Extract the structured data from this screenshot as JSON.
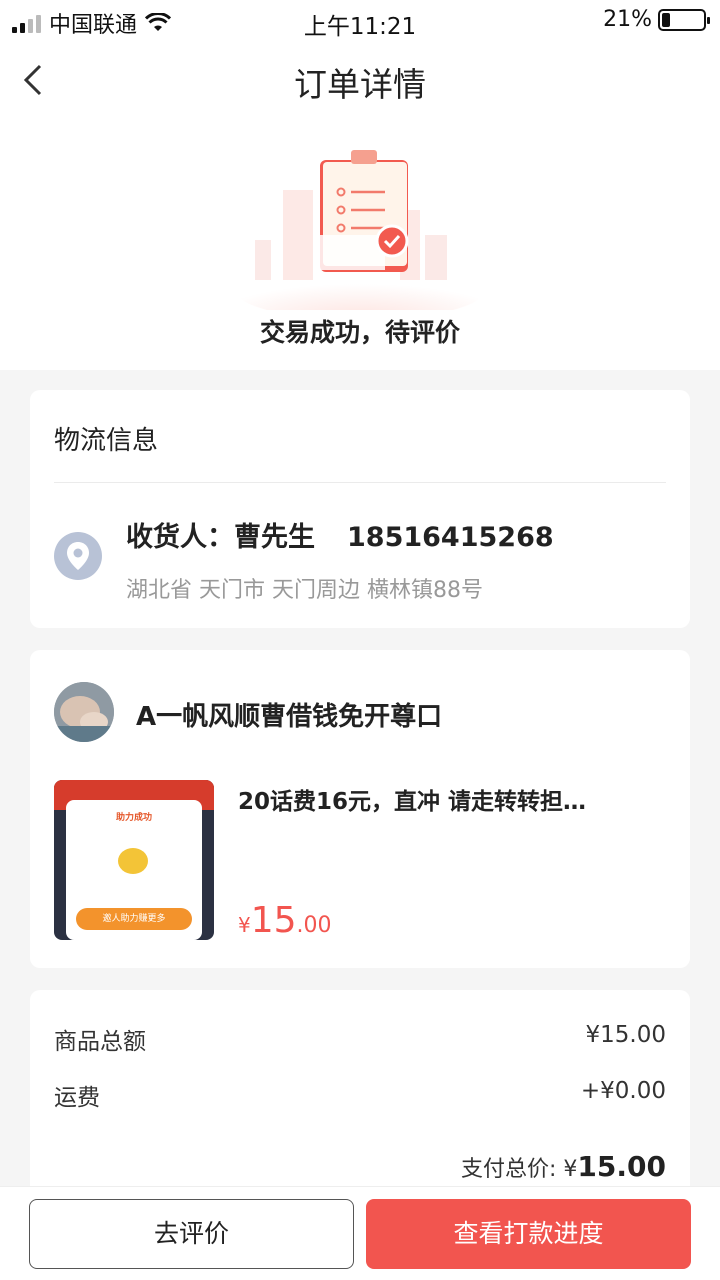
{
  "status_bar": {
    "carrier": "中国联通",
    "time": "上午11:21",
    "battery_percent": "21%",
    "battery_level": 0.21
  },
  "nav": {
    "title": "订单详情"
  },
  "hero": {
    "status_text": "交易成功，待评价"
  },
  "logistics": {
    "title": "物流信息",
    "receiver_label": "收货人：曹先生",
    "phone": "18516415268",
    "address": "湖北省 天门市 天门周边 横林镇88号"
  },
  "product": {
    "shop_name": "A一帆风顺曹借钱免开尊口",
    "name": "20话费16元，直冲 请走转转担…",
    "price_currency": "¥",
    "price_int": "15",
    "price_dec": ".00",
    "thumb_title": "助力成功",
    "thumb_button": "邀人助力赚更多"
  },
  "summary": {
    "goods_label": "商品总额",
    "goods_value": "¥15.00",
    "shipping_label": "运费",
    "shipping_value": "+¥0.00",
    "total_label": "支付总价: ¥",
    "total_value": "15.00"
  },
  "actions": {
    "review_label": "去评价",
    "progress_label": "查看打款进度"
  },
  "colors": {
    "accent": "#f2554f",
    "location_icon_bg": "#b8c2d6"
  }
}
